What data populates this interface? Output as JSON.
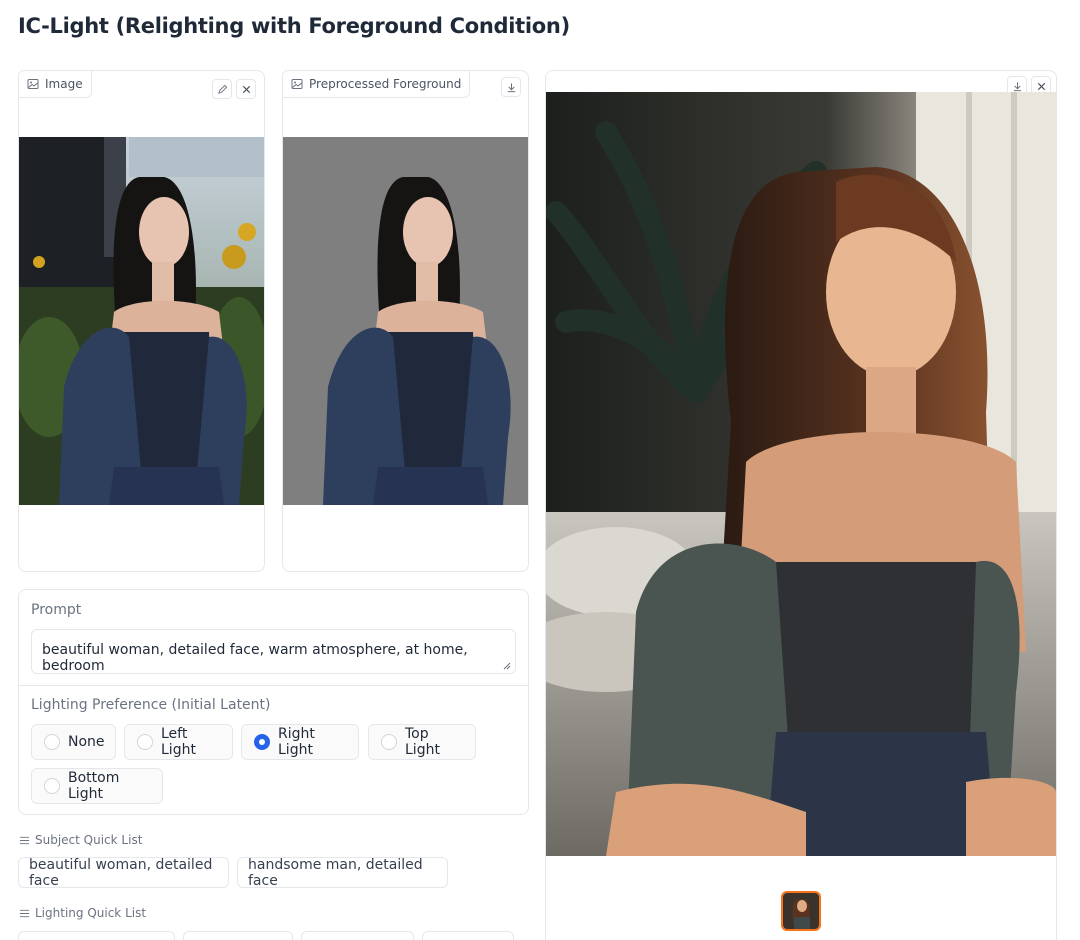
{
  "page": {
    "title": "IC-Light (Relighting with Foreground Condition)"
  },
  "image_input": {
    "label": "Image",
    "edit_icon": "pencil-icon",
    "clear_icon": "close-icon",
    "label_icon": "image-icon"
  },
  "preprocessed": {
    "label": "Preprocessed Foreground",
    "download_icon": "download-icon",
    "label_icon": "image-icon"
  },
  "output_gallery": {
    "download_icon": "download-icon",
    "close_icon": "close-icon"
  },
  "prompt": {
    "label": "Prompt",
    "value": "beautiful woman, detailed face, warm atmosphere, at home, bedroom"
  },
  "lighting": {
    "label": "Lighting Preference (Initial Latent)",
    "options": [
      "None",
      "Left Light",
      "Right Light",
      "Top Light",
      "Bottom Light"
    ],
    "selected": "Right Light"
  },
  "subject_quick_list": {
    "title": "Subject Quick List",
    "items": [
      "beautiful woman, detailed face",
      "handsome man, detailed face"
    ]
  },
  "lighting_quick_list": {
    "title": "Lighting Quick List"
  },
  "colors": {
    "accent": "#2563eb",
    "thumb_border": "#f97316"
  }
}
